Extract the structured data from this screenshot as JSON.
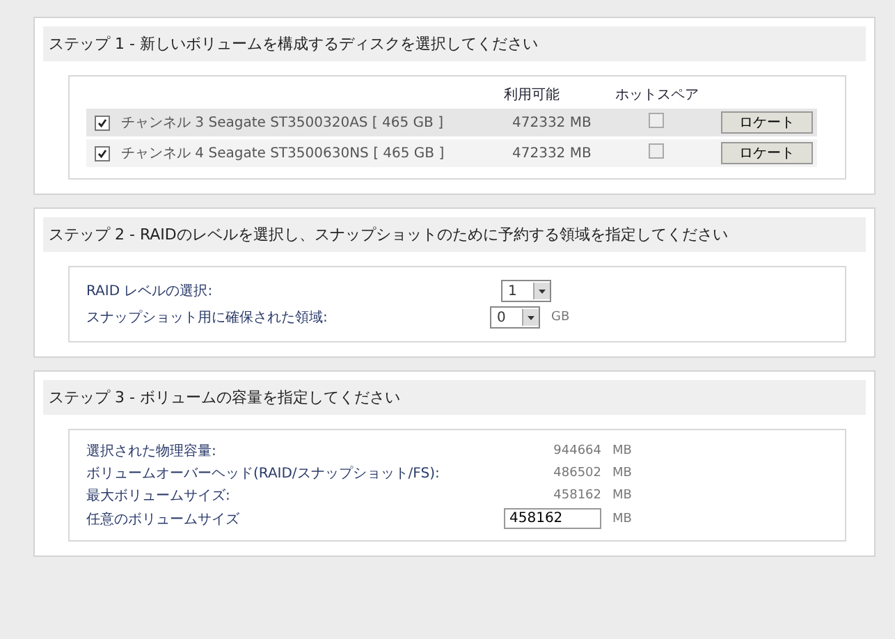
{
  "steps": [
    {
      "kind": "disks",
      "title": "ステップ 1 - 新しいボリュームを構成するディスクを選択してください",
      "columns": [
        "利用可能",
        "ホットスペア"
      ],
      "disks": [
        {
          "label": "チャンネル 3 Seagate ST3500320AS [ 465 GB ]",
          "checked": true,
          "available": "472332 MB",
          "hot_spare": false,
          "button": "ロケート"
        },
        {
          "label": "チャンネル 4 Seagate ST3500630NS [ 465 GB ]",
          "checked": true,
          "available": "472332 MB",
          "hot_spare": false,
          "button": "ロケート"
        }
      ]
    },
    {
      "kind": "raid",
      "title": "ステップ 2 - RAIDのレベルを選択し、スナップショットのために予約する領域を指定してください",
      "fields": [
        {
          "label": "RAID レベルの選択:",
          "value": "1"
        },
        {
          "label": "スナップショット用に確保された領域:",
          "value": "0",
          "unit": "GB"
        }
      ]
    },
    {
      "kind": "capacity",
      "title": "ステップ 3 - ボリュームの容量を指定してください",
      "rows": [
        {
          "kind": "text",
          "label": "選択された物理容量:",
          "value": "944664",
          "unit": "MB"
        },
        {
          "kind": "text",
          "label": "ボリュームオーバーヘッド(RAID/スナップショット/FS):",
          "value": "486502",
          "unit": "MB"
        },
        {
          "kind": "text",
          "label": "最大ボリュームサイズ:",
          "value": "458162",
          "unit": "MB"
        },
        {
          "kind": "input",
          "label": "任意のボリュームサイズ",
          "value": "458162",
          "unit": "MB"
        }
      ]
    }
  ]
}
